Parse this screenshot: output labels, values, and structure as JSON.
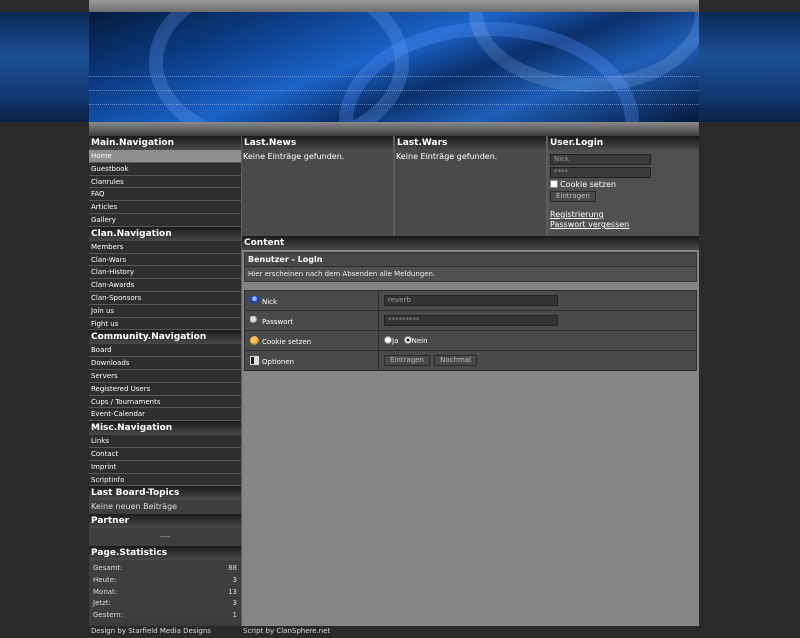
{
  "main_nav": {
    "title": "Main.Navigation",
    "items": [
      "Home",
      "Guestbook",
      "Clanrules",
      "FAQ",
      "Articles",
      "Gallery"
    ]
  },
  "clan_nav": {
    "title": "Clan.Navigation",
    "items": [
      "Members",
      "Clan-Wars",
      "Clan-History",
      "Clan-Awards",
      "Clan-Sponsors",
      "Join us",
      "Fight us"
    ]
  },
  "community_nav": {
    "title": "Community.Navigation",
    "items": [
      "Board",
      "Downloads",
      "Servers",
      "Registered Users",
      "Cups / Tournaments",
      "Event-Calendar"
    ]
  },
  "misc_nav": {
    "title": "Misc.Navigation",
    "items": [
      "Links",
      "Contact",
      "Imprint",
      "Scriptinfo"
    ]
  },
  "board_topics": {
    "title": "Last Board-Topics",
    "empty": "Keine neuen Beiträge"
  },
  "partner": {
    "title": "Partner",
    "value": "----"
  },
  "page_stats": {
    "title": "Page.Statistics",
    "rows": [
      {
        "label": "Gesamt:",
        "value": "88"
      },
      {
        "label": "Heute:",
        "value": "3"
      },
      {
        "label": "Monat:",
        "value": "13"
      },
      {
        "label": "Jetzt:",
        "value": "3"
      },
      {
        "label": "Gestern:",
        "value": "1"
      }
    ]
  },
  "last_news": {
    "title": "Last.News",
    "text": "Keine Einträge gefunden."
  },
  "last_wars": {
    "title": "Last.Wars",
    "text": "Keine Einträge gefunden."
  },
  "user_login": {
    "title": "User.Login",
    "nick_placeholder": "Nick",
    "password_value": "****",
    "cookie_label": "Cookie setzen",
    "submit": "Eintragen",
    "register": "Registrierung",
    "forgot": "Passwort vergessen"
  },
  "content": {
    "title": "Content",
    "box_title": "Benutzer - Login",
    "message": "Hier erscheinen nach dem Absenden alle Meldungen.",
    "nick_label": "Nick",
    "nick_value": "reverb",
    "password_label": "Passwort",
    "password_value": "*********",
    "cookie_label": "Cookie setzen",
    "radio_yes": "Ja",
    "radio_no": "Nein",
    "options_label": "Optionen",
    "submit": "Eintragen",
    "reset": "Nochmal"
  },
  "footer": {
    "design": "Design by Starfield Media Designs",
    "script": "Script by ClanSphere.net"
  },
  "colors": {
    "accent_blue": "#1b63c9",
    "panel": "#4a4a4a",
    "content_bg": "#858585"
  }
}
